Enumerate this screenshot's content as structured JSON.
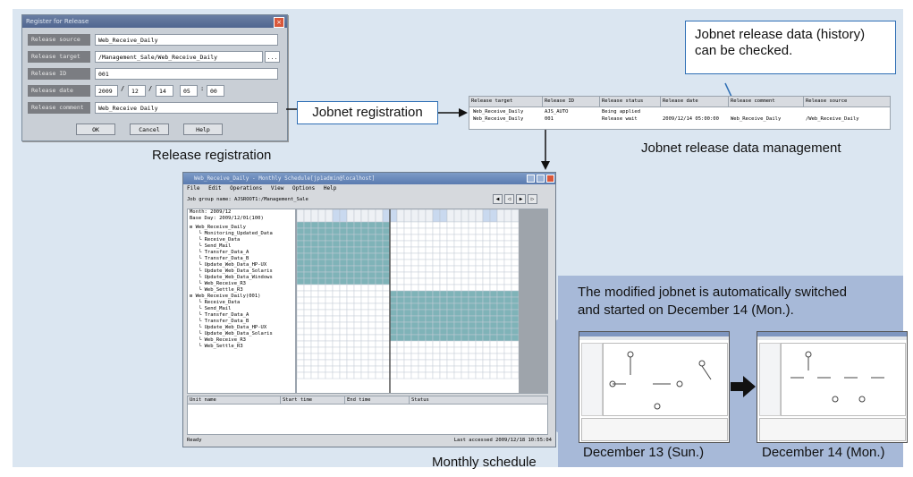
{
  "register_dialog": {
    "title": "Register for Release",
    "rows": [
      {
        "label": "Release source",
        "value": "Web_Receive_Daily"
      },
      {
        "label": "Release target",
        "value": "/Management_Sale/Web_Receive_Daily"
      },
      {
        "label": "Release ID",
        "value": "001"
      },
      {
        "label": "Release date",
        "date": [
          "2009",
          "12",
          "14",
          "05",
          "00"
        ]
      },
      {
        "label": "Release comment",
        "value": "Web_Receive Daily"
      }
    ],
    "browse_label": "...",
    "buttons": {
      "ok": "OK",
      "cancel": "Cancel",
      "help": "Help"
    }
  },
  "captions": {
    "release_registration": "Release registration",
    "jobnet_release_mgmt": "Jobnet release data management",
    "monthly_schedule": "Monthly schedule",
    "dec13": "December 13 (Sun.)",
    "dec14": "December 14 (Mon.)"
  },
  "callouts": {
    "jobnet_registration": "Jobnet registration",
    "history_line1": "Jobnet release data (history)",
    "history_line2": "can be checked."
  },
  "release_table": {
    "headers": [
      "Release target",
      "Release ID",
      "Release status",
      "Release date",
      "Release comment",
      "Release source"
    ],
    "rows": [
      [
        "Web_Receive_Daily",
        "AJS_AUTO",
        "Being applied",
        "",
        "",
        ""
      ],
      [
        "Web_Receive_Daily",
        "001",
        "Release wait",
        "2009/12/14 05:00:00",
        "Web_Receive_Daily",
        "/Web_Receive_Daily"
      ]
    ]
  },
  "schedule_window": {
    "title": "Web_Receive_Daily - Monthly Schedule[jp1admin@localhost]",
    "menu": [
      "File",
      "Edit",
      "Operations",
      "View",
      "Options",
      "Help"
    ],
    "job_group": "Job group name: AJSROOT1:/Management_Sale",
    "month": "Month:  2009/12",
    "base_day": "Base Day: 2009/12/01(100)",
    "tree": [
      {
        "indent": 0,
        "text": "Web_Receive_Daily"
      },
      {
        "indent": 1,
        "text": "Monitoring_Updated_Data"
      },
      {
        "indent": 1,
        "text": "Receive_Data"
      },
      {
        "indent": 1,
        "text": "Send_Mail"
      },
      {
        "indent": 1,
        "text": "Transfer_Data_A"
      },
      {
        "indent": 1,
        "text": "Transfer_Data_B"
      },
      {
        "indent": 1,
        "text": "Update_Web_Data_HP-UX"
      },
      {
        "indent": 1,
        "text": "Update_Web_Data_Solaris"
      },
      {
        "indent": 1,
        "text": "Update_Web_Data_Windows"
      },
      {
        "indent": 1,
        "text": "Web_Receive_R3"
      },
      {
        "indent": 1,
        "text": "Web_Settle_R3"
      },
      {
        "indent": 0,
        "text": "Web_Receive_Daily(001)"
      },
      {
        "indent": 1,
        "text": "Receive_Data"
      },
      {
        "indent": 1,
        "text": "Send_Mail"
      },
      {
        "indent": 1,
        "text": "Transfer_Data_A"
      },
      {
        "indent": 1,
        "text": "Transfer_Data_B"
      },
      {
        "indent": 1,
        "text": "Update_Web_Data_HP-UX"
      },
      {
        "indent": 1,
        "text": "Update_Web_Data_Solaris"
      },
      {
        "indent": 1,
        "text": "Web_Receive_R3"
      },
      {
        "indent": 1,
        "text": "Web_Settle_R3"
      }
    ],
    "bottom_headers": [
      "Unit name",
      "Start time",
      "End time",
      "Status"
    ],
    "status_left": "Ready",
    "status_right": "Last accessed 2009/12/18 10:55:04"
  },
  "info_box": {
    "line1": "The modified jobnet is automatically switched",
    "line2": "and started on December 14 (Mon.)."
  },
  "colors": {
    "panel": "#dbe6f1",
    "callout_border": "#2f6fb5",
    "info_box": "#a7b9d8",
    "cell_teal": "#7fb3b8"
  }
}
